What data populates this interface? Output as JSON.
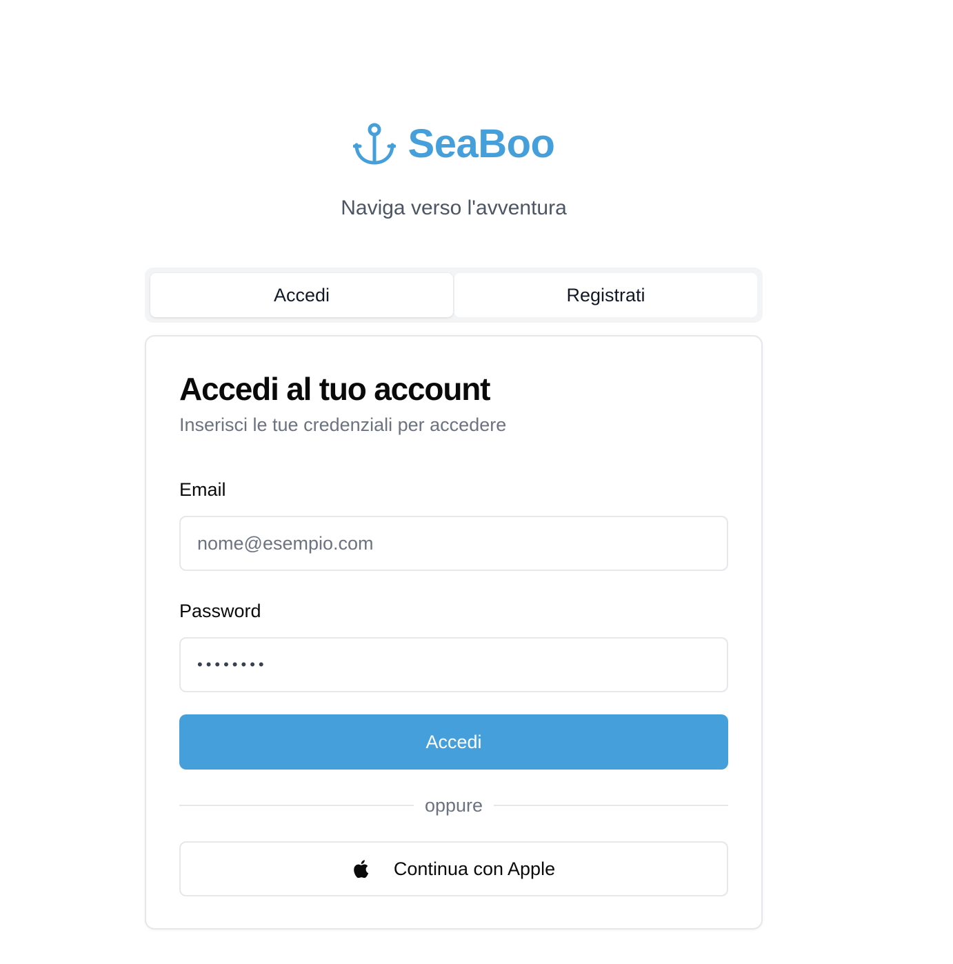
{
  "brand": {
    "name": "SeaBoo",
    "icon": "anchor-icon",
    "color": "#459fdb"
  },
  "tagline": "Naviga verso l'avventura",
  "tabs": [
    {
      "label": "Accedi",
      "active": true
    },
    {
      "label": "Registrati",
      "active": false
    }
  ],
  "login": {
    "title": "Accedi al tuo account",
    "subtitle": "Inserisci le tue credenziali per accedere",
    "email_label": "Email",
    "email_placeholder": "nome@esempio.com",
    "email_value": "",
    "password_label": "Password",
    "password_value": "••••••••",
    "submit_label": "Accedi",
    "divider_text": "oppure",
    "apple_label": "Continua con Apple",
    "apple_icon": "apple-icon"
  },
  "colors": {
    "accent": "#459fdb",
    "text": "#0a0a0a",
    "muted": "#6b7280",
    "border": "#e5e7eb"
  }
}
